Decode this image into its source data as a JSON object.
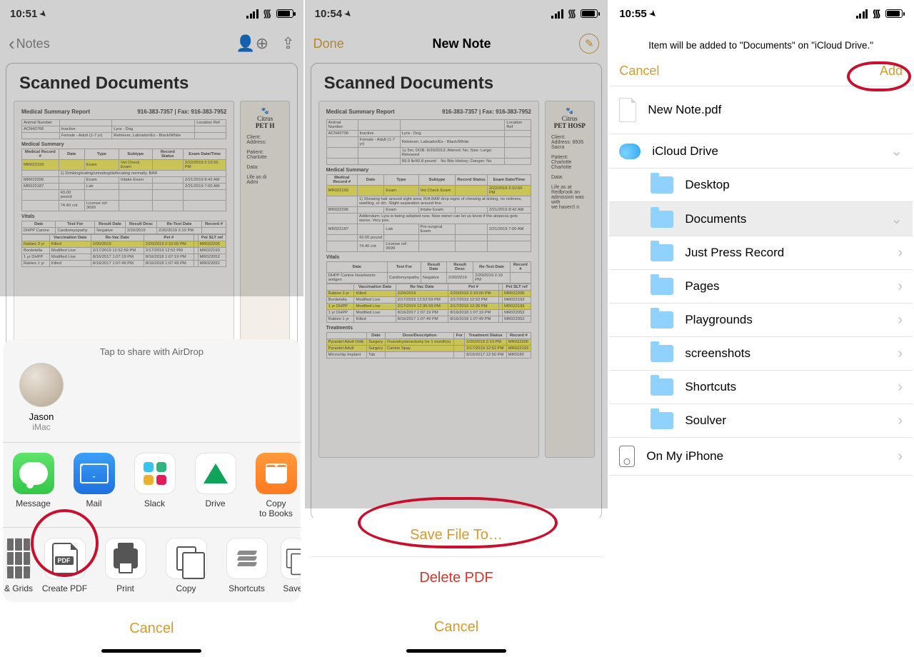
{
  "p1": {
    "time": "10:51",
    "back": "Notes",
    "note_title": "Scanned Documents",
    "doc_header": "Medical Summary Report",
    "doc_phone": "916-383-7357 | Fax: 916-383-7952",
    "doc_section_summary": "Medical Summary",
    "side_brand_top": "Citrus",
    "side_brand_mid": "PET H",
    "airdrop_header": "Tap to share with AirDrop",
    "contact_name": "Jason",
    "contact_device": "iMac",
    "apps": {
      "message": "Message",
      "mail": "Mail",
      "slack": "Slack",
      "drive": "Drive",
      "books": "Copy\nto Books"
    },
    "actions": {
      "grids": "& Grids",
      "pdf": "Create PDF",
      "print": "Print",
      "copy": "Copy",
      "shortcuts": "Shortcuts",
      "save": "Save"
    },
    "cancel": "Cancel"
  },
  "p2": {
    "time": "10:54",
    "done": "Done",
    "title": "New Note",
    "note_title": "Scanned Documents",
    "doc_header": "Medical Summary Report",
    "doc_phone": "916-383-7357 | Fax: 916-383-7952",
    "doc_section_summary": "Medical Summary",
    "side_brand_top": "Citrus",
    "side_brand_mid": "PET HOSP",
    "save": "Save File To…",
    "delete": "Delete PDF",
    "cancel": "Cancel"
  },
  "p3": {
    "time": "10:55",
    "hint": "Item will be added to \"Documents\" on \"iCloud Drive.\"",
    "cancel": "Cancel",
    "add": "Add",
    "filename": "New Note.pdf",
    "icloud": "iCloud Drive",
    "folders": {
      "desktop": "Desktop",
      "documents": "Documents",
      "jpr": "Just Press Record",
      "pages": "Pages",
      "playgrounds": "Playgrounds",
      "screenshots": "screenshots",
      "shortcuts": "Shortcuts",
      "soulver": "Soulver"
    },
    "on_iphone": "On My iPhone"
  }
}
